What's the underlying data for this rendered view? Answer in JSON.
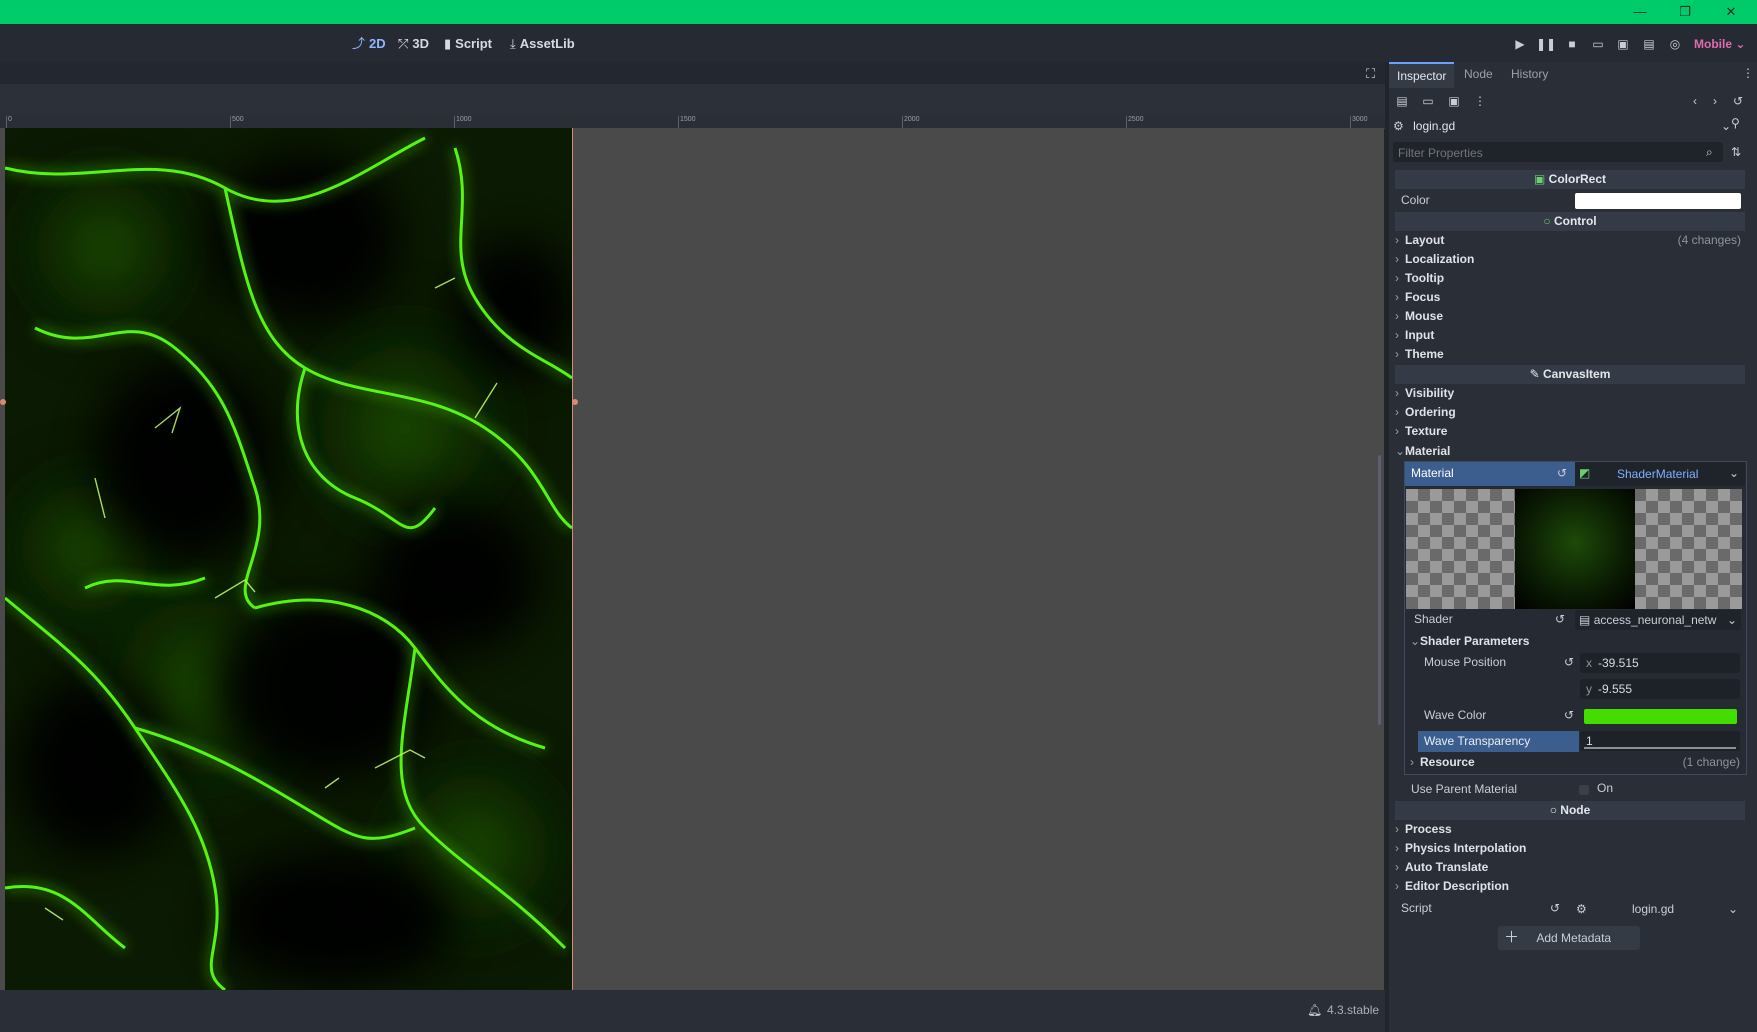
{
  "window": {
    "minimize_glyph": "—",
    "maximize_glyph": "❐",
    "close_glyph": "✕",
    "titlebar_color": "#00cb6b"
  },
  "workspaces": {
    "tab_2d": "2D",
    "tab_3d": "3D",
    "tab_script": "Script",
    "tab_assetlib": "AssetLib",
    "active": "2D"
  },
  "run_bar": {
    "renderer": "Mobile"
  },
  "ruler": {
    "labels": [
      "0",
      "500",
      "1000",
      "1500",
      "2000",
      "2500",
      "3000"
    ]
  },
  "status": {
    "version": "4.3.stable"
  },
  "inspector": {
    "tabs": [
      "Inspector",
      "Node",
      "History"
    ],
    "resource_name": "login.gd",
    "filter_placeholder": "Filter Properties",
    "sections": {
      "colorrect": "ColorRect",
      "control": "Control",
      "canvasitem": "CanvasItem",
      "node": "Node"
    },
    "color_label": "Color",
    "color_value": "#ffffff",
    "control_groups": [
      {
        "label": "Layout",
        "note": "(4 changes)"
      },
      {
        "label": "Localization"
      },
      {
        "label": "Tooltip"
      },
      {
        "label": "Focus"
      },
      {
        "label": "Mouse"
      },
      {
        "label": "Input"
      },
      {
        "label": "Theme"
      }
    ],
    "canvas_groups": [
      "Visibility",
      "Ordering",
      "Texture",
      "Material"
    ],
    "material": {
      "label": "Material",
      "value": "ShaderMaterial",
      "shader_label": "Shader",
      "shader_value": "access_neuronal_netw",
      "shader_params_label": "Shader Parameters",
      "mouse_position_label": "Mouse Position",
      "mouse_x_axis": "x",
      "mouse_y_axis": "y",
      "mouse_x": "-39.515",
      "mouse_y": "-9.555",
      "wave_color_label": "Wave Color",
      "wave_color": "#44dd00",
      "wave_transparency_label": "Wave Transparency",
      "wave_transparency": "1",
      "resource_label": "Resource",
      "resource_note": "(1 change)"
    },
    "use_parent_material_label": "Use Parent Material",
    "use_parent_material_value": "On",
    "node_groups": [
      "Process",
      "Physics Interpolation",
      "Auto Translate",
      "Editor Description"
    ],
    "script_label": "Script",
    "script_value": "login.gd",
    "add_metadata": "Add Metadata"
  }
}
